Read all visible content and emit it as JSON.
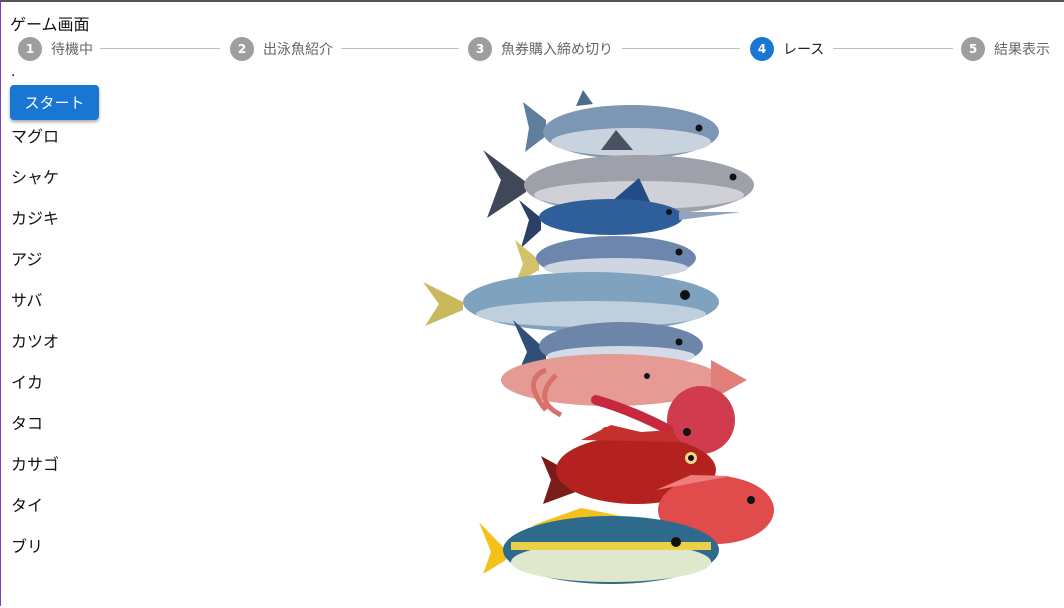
{
  "page": {
    "title": "ゲーム画面"
  },
  "stepper": {
    "steps": [
      {
        "number": "1",
        "label": "待機中",
        "active": false
      },
      {
        "number": "2",
        "label": "出泳魚紹介",
        "active": false
      },
      {
        "number": "3",
        "label": "魚券購入締め切り",
        "active": false
      },
      {
        "number": "4",
        "label": "レース",
        "active": true
      },
      {
        "number": "5",
        "label": "結果表示",
        "active": false
      }
    ],
    "active_color": "#1976d2",
    "inactive_color": "#9e9e9e"
  },
  "status_mark": ".",
  "start_button": {
    "label": "スタート",
    "color": "#1976d2"
  },
  "fish_list": [
    "マグロ",
    "シャケ",
    "カジキ",
    "アジ",
    "サバ",
    "カツオ",
    "イカ",
    "タコ",
    "カサゴ",
    "タイ",
    "ブリ"
  ]
}
